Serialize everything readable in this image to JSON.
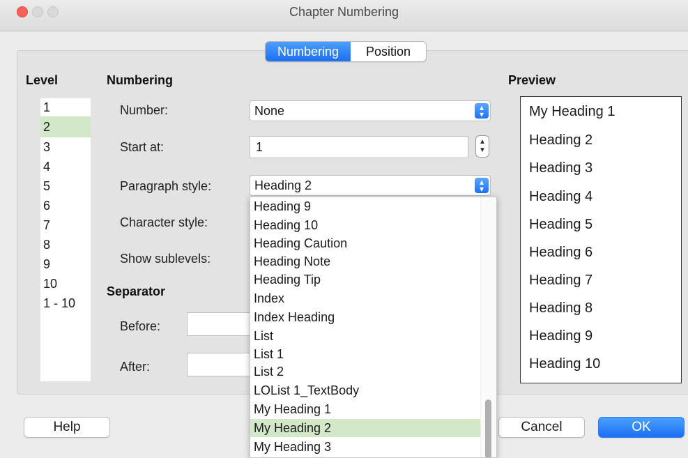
{
  "window": {
    "title": "Chapter Numbering"
  },
  "tabs": [
    {
      "label": "Numbering"
    },
    {
      "label": "Position"
    }
  ],
  "level": {
    "heading": "Level",
    "items": [
      "1",
      "2",
      "3",
      "4",
      "5",
      "6",
      "7",
      "8",
      "9",
      "10",
      "1 - 10"
    ],
    "selected": "2"
  },
  "numbering": {
    "heading": "Numbering",
    "number_label": "Number:",
    "number_value": "None",
    "start_at_label": "Start at:",
    "start_at_value": "1",
    "paragraph_style_label": "Paragraph style:",
    "paragraph_style_value": "Heading 2",
    "character_style_label": "Character style:",
    "show_sublevels_label": "Show sublevels:"
  },
  "separator": {
    "heading": "Separator",
    "before_label": "Before:",
    "after_label": "After:"
  },
  "dropdown": {
    "items": [
      "Heading 9",
      "Heading 10",
      "Heading Caution",
      "Heading Note",
      "Heading Tip",
      "Index",
      "Index Heading",
      "List",
      "List 1",
      "List 2",
      "LOList 1_TextBody",
      "My Heading 1",
      "My Heading 2",
      "My Heading 3"
    ],
    "selected": "My Heading 2"
  },
  "preview": {
    "heading": "Preview",
    "items": [
      "My Heading 1",
      "Heading 2",
      "Heading 3",
      "Heading 4",
      "Heading 5",
      "Heading 6",
      "Heading 7",
      "Heading 8",
      "Heading 9",
      "Heading 10"
    ]
  },
  "buttons": {
    "help": "Help",
    "cancel": "Cancel",
    "ok": "OK"
  },
  "colors": {
    "accent": "#1d6ff1",
    "selection": "#d2e8c9",
    "close": "#fc605b"
  }
}
